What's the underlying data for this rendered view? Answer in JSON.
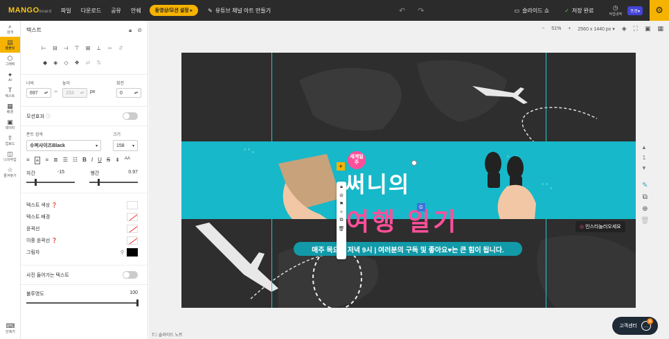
{
  "app": {
    "logo_text": "MANGO",
    "logo_sub": "board",
    "menu": [
      "파일",
      "다운로드",
      "공유",
      "안쉐"
    ],
    "motion_btn": "동영상/모션 설정",
    "doc_title": "유튜브 채널 아트 만들기",
    "slideshow": "슬라이드 쇼",
    "saved": "저장 완료",
    "history": "작업내역",
    "pro": "프로"
  },
  "leftcol": {
    "items": [
      {
        "icon": "⌕",
        "label": "검색"
      },
      {
        "icon": "▤",
        "label": "템플릿"
      },
      {
        "icon": "⬡",
        "label": "그래픽"
      },
      {
        "icon": "✦",
        "label": "AI"
      },
      {
        "icon": "T",
        "label": "텍스트"
      },
      {
        "icon": "▦",
        "label": "배경"
      },
      {
        "icon": "▣",
        "label": "데이터"
      },
      {
        "icon": "⇧",
        "label": "업로드"
      },
      {
        "icon": "◫",
        "label": "나의작업"
      },
      {
        "icon": "☆",
        "label": "즐겨찾기"
      }
    ],
    "bottom": "단축키"
  },
  "panel": {
    "title": "텍스트",
    "width_label": "너비",
    "height_label": "높이",
    "rotate_label": "회전",
    "width": "697",
    "height": "153",
    "unit": "px",
    "rotate": "0",
    "motion_label": "모션효과",
    "font_label": "폰트 검색",
    "size_label": "크기",
    "font_value": "수퍼사이즈Black",
    "size_value": "158",
    "letter_label": "자간",
    "letter_value": "-15",
    "line_label": "행간",
    "line_value": "0.97",
    "text_color": "텍스트 색상",
    "text_bg": "텍스트 배경",
    "outline": "윤곽선",
    "double_outline": "이중 윤곽선",
    "shadow": "그림자",
    "photo_text": "사진 들어가는 텍스트",
    "opacity_label": "불투명도",
    "opacity_value": "100"
  },
  "workspace": {
    "zoom": "51%",
    "canvas_size": "2560 x 1440 px",
    "page_num": "1",
    "notes": "슬라이드 노트",
    "help": "고객센터",
    "help_badge": "11"
  },
  "design": {
    "title_line1": "써니의",
    "title_line2": "여행 일기",
    "badge_small": "세계일주",
    "sub_line": "매주 목요일 저녁 9시 | 여러분의 구독 및 좋아요♥는 큰 힘이 됩니다.",
    "insta": "인스타놀러오세요"
  }
}
